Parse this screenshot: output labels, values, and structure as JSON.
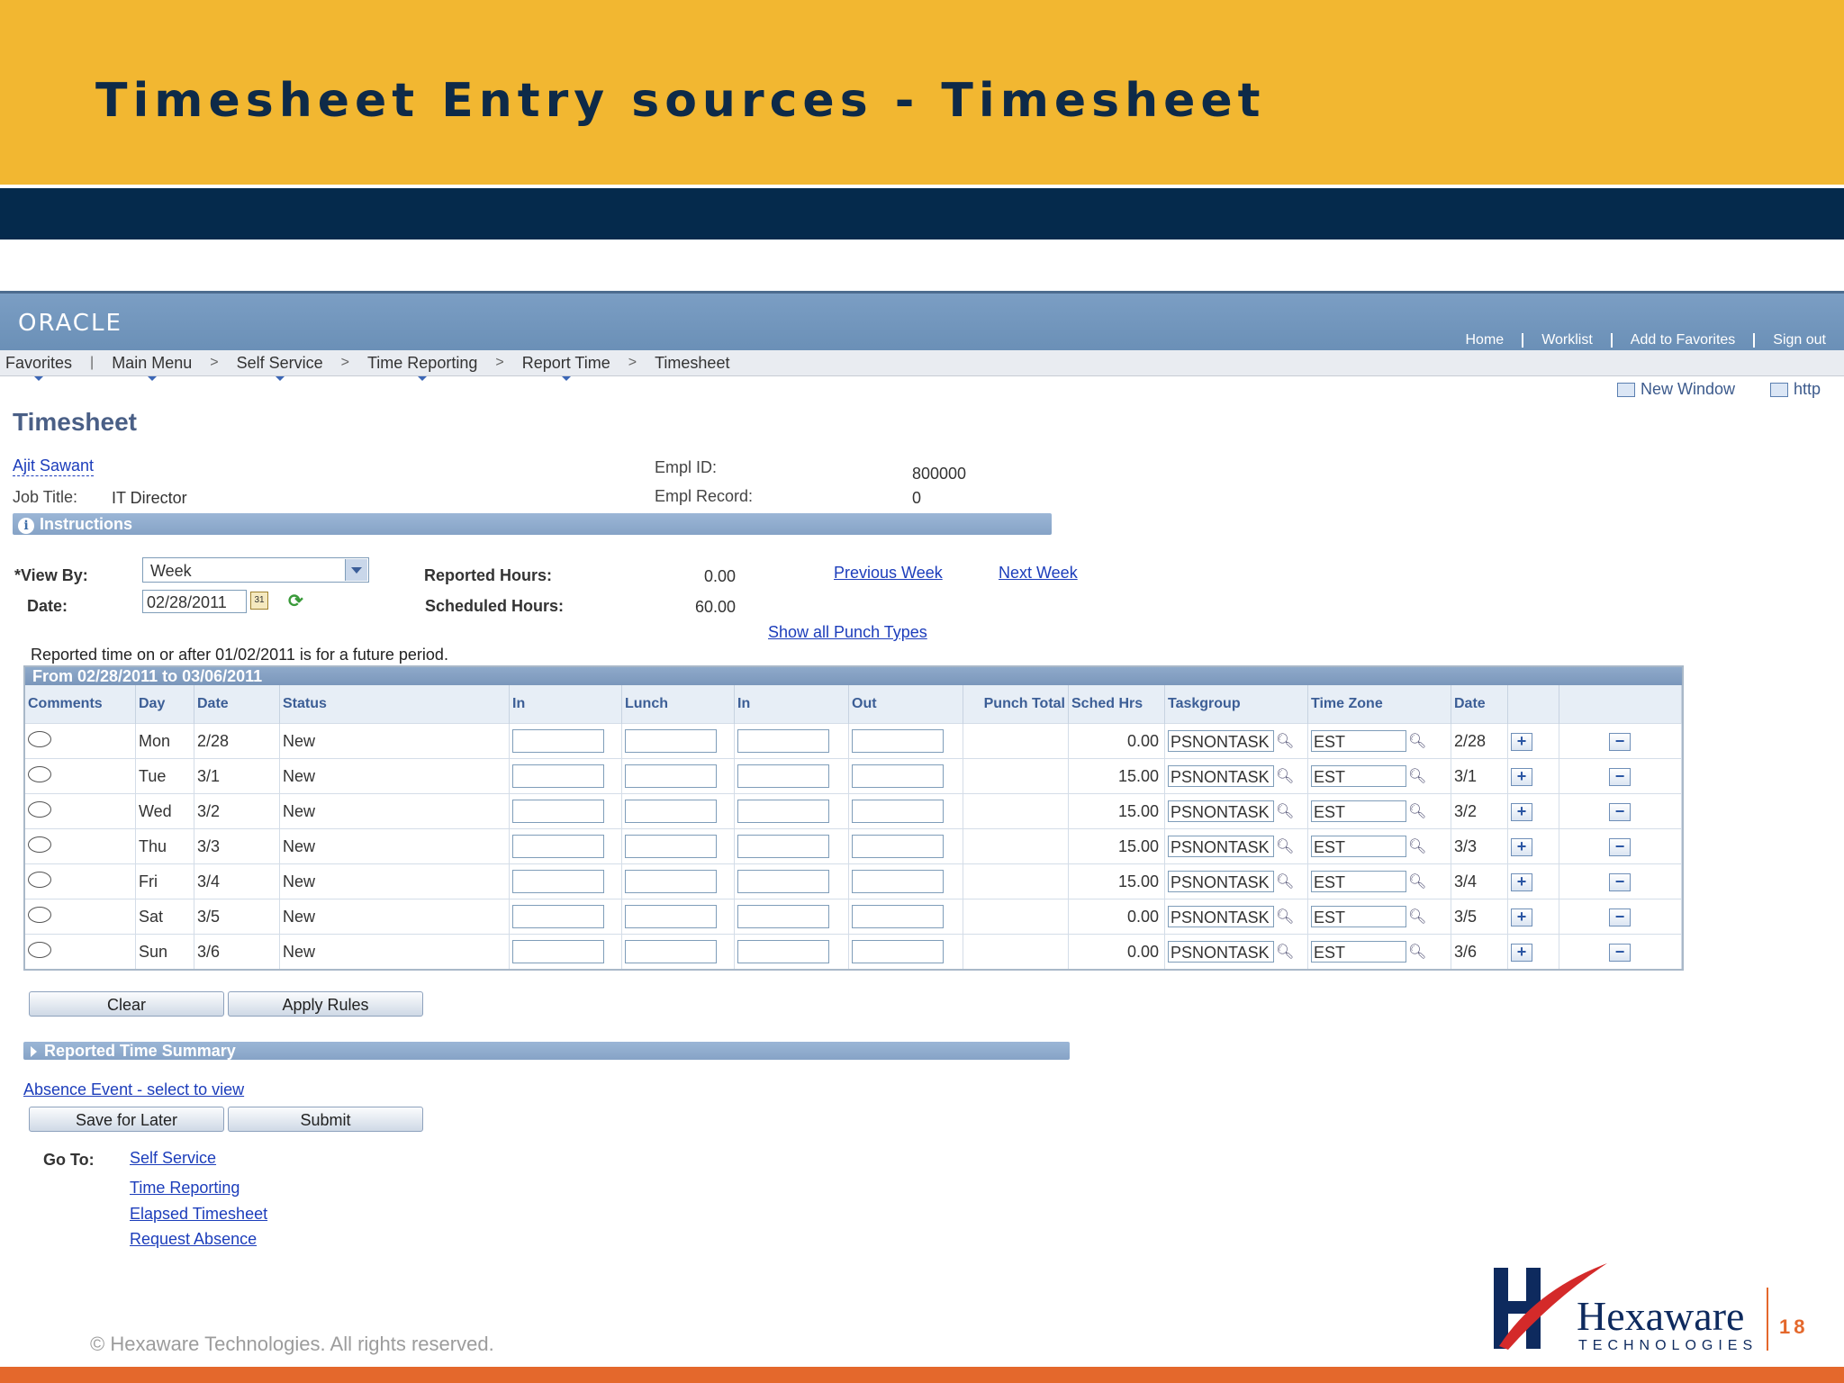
{
  "slide": {
    "title": "Timesheet Entry sources  - Timesheet",
    "copyright": "© Hexaware Technologies. All rights reserved.",
    "page_number": "18",
    "logo_name": "Hexaware",
    "logo_sub": "TECHNOLOGIES",
    "colors": {
      "header": "#f2b731",
      "band": "#052a4c",
      "footer": "#e4682c"
    }
  },
  "app": {
    "brand": "ORACLE",
    "top_links": [
      "Home",
      "Worklist",
      "Add to Favorites",
      "Sign out"
    ],
    "nav": [
      "Favorites",
      "Main Menu",
      "Self Service",
      "Time Reporting",
      "Report Time",
      "Timesheet"
    ],
    "new_window": "New Window",
    "http": "http",
    "page_title": "Timesheet",
    "employee": {
      "name": "Ajit Sawant",
      "job_title_label": "Job Title:",
      "job_title": "IT Director",
      "empl_id_label": "Empl ID:",
      "empl_id": "800000",
      "empl_record_label": "Empl Record:",
      "empl_record": "0"
    },
    "instructions": "Instructions",
    "view_by_label": "*View By:",
    "view_by_value": "Week",
    "date_label": "Date:",
    "date_value": "02/28/2011",
    "cal_icon_text": "31",
    "reported_hours_label": "Reported Hours:",
    "reported_hours": "0.00",
    "scheduled_hours_label": "Scheduled Hours:",
    "scheduled_hours": "60.00",
    "previous_week": "Previous Week",
    "next_week": "Next Week",
    "show_punch": "Show all Punch Types",
    "future_note": "Reported time on or after 01/02/2011 is for a future period.",
    "grid_caption": "From 02/28/2011 to 03/06/2011",
    "columns": [
      "Comments",
      "Day",
      "Date",
      "Status",
      "In",
      "Lunch",
      "In",
      "Out",
      "Punch Total",
      "Sched Hrs",
      "Taskgroup",
      "Time Zone",
      "Date"
    ],
    "rows": [
      {
        "day": "Mon",
        "date": "2/28",
        "status": "New",
        "sched": "0.00",
        "taskgroup": "PSNONTASK",
        "tz": "EST",
        "date2": "2/28"
      },
      {
        "day": "Tue",
        "date": "3/1",
        "status": "New",
        "sched": "15.00",
        "taskgroup": "PSNONTASK",
        "tz": "EST",
        "date2": "3/1"
      },
      {
        "day": "Wed",
        "date": "3/2",
        "status": "New",
        "sched": "15.00",
        "taskgroup": "PSNONTASK",
        "tz": "EST",
        "date2": "3/2"
      },
      {
        "day": "Thu",
        "date": "3/3",
        "status": "New",
        "sched": "15.00",
        "taskgroup": "PSNONTASK",
        "tz": "EST",
        "date2": "3/3"
      },
      {
        "day": "Fri",
        "date": "3/4",
        "status": "New",
        "sched": "15.00",
        "taskgroup": "PSNONTASK",
        "tz": "EST",
        "date2": "3/4"
      },
      {
        "day": "Sat",
        "date": "3/5",
        "status": "New",
        "sched": "0.00",
        "taskgroup": "PSNONTASK",
        "tz": "EST",
        "date2": "3/5"
      },
      {
        "day": "Sun",
        "date": "3/6",
        "status": "New",
        "sched": "0.00",
        "taskgroup": "PSNONTASK",
        "tz": "EST",
        "date2": "3/6"
      }
    ],
    "clear": "Clear",
    "apply_rules": "Apply Rules",
    "reported_summary": "Reported Time Summary",
    "absence_event": "Absence Event - select to view",
    "save_later": "Save for Later",
    "submit": "Submit",
    "goto_label": "Go To:",
    "goto_links": [
      "Self Service",
      "Time Reporting",
      "Elapsed Timesheet",
      "Request Absence"
    ]
  }
}
